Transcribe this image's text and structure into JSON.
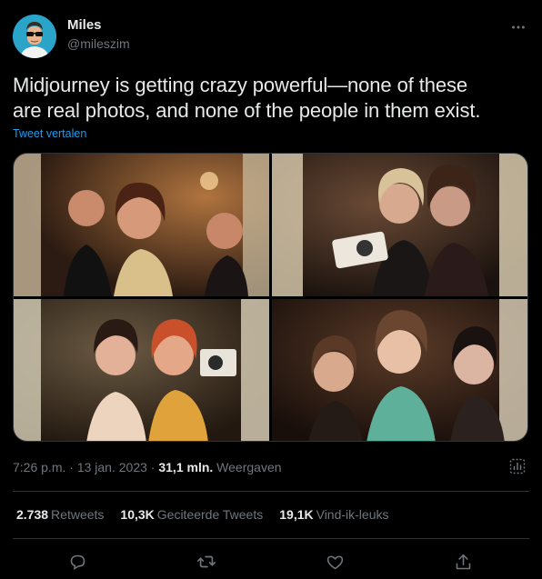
{
  "author": {
    "name": "Miles",
    "handle": "@mileszim"
  },
  "tweet": {
    "text_line1": "Midjourney is getting crazy powerful—none of these",
    "text_line2": "are real photos, and none of the people in them exist.",
    "translate_label": "Tweet vertalen"
  },
  "meta": {
    "time": "7:26 p.m.",
    "sep1": "·",
    "date": "13 jan. 2023",
    "sep2": "·",
    "views_count": "31,1 mln.",
    "views_label": "Weergaven"
  },
  "stats": [
    {
      "count": "2.738",
      "label": "Retweets"
    },
    {
      "count": "10,3K",
      "label": "Geciteerde Tweets"
    },
    {
      "count": "19,1K",
      "label": "Vind-ik-leuks"
    }
  ],
  "icons": {
    "more": "more-icon",
    "analytics": "analytics-icon",
    "reply": "reply-icon",
    "retweet": "retweet-icon",
    "like": "like-icon",
    "share": "share-icon"
  },
  "colors": {
    "accent": "#1d9bf0",
    "text": "#e7e9ea",
    "secondary": "#71767b",
    "border": "#2f3336",
    "background": "#000000"
  }
}
